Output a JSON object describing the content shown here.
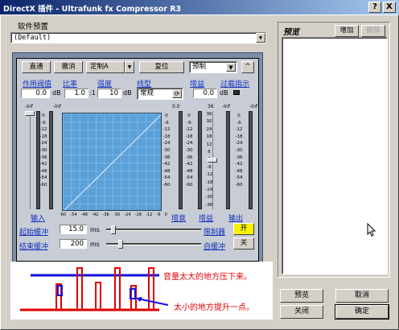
{
  "window": {
    "title": "DirectX 插件 - Ultrafunk fx Compressor R3",
    "help_label": "?",
    "close_label": "X"
  },
  "preset": {
    "label": "软件预置",
    "value": "(Default)"
  },
  "toolbar": {
    "direct": "直通",
    "undo": "撤消",
    "define": "定制A",
    "reset": "复位",
    "presets": "预制",
    "collapse": "^"
  },
  "params": {
    "attack": {
      "label": "作用阀值",
      "value": "0.0",
      "unit": "dB"
    },
    "ratio": {
      "label": "比率",
      "value": "1.0",
      "unit": ":1"
    },
    "strength": {
      "label": "强度",
      "value": "10",
      "unit": "dB"
    },
    "curve": {
      "label": "线型",
      "value": "常规"
    },
    "gain": {
      "label": "增益",
      "value": "0.0",
      "unit": "dB"
    },
    "oversample": {
      "label": "过载指示"
    }
  },
  "meters": {
    "input_top": [
      "-Inf",
      "-Inf"
    ],
    "input_scale": [
      "0",
      "-6",
      "-12",
      "-18",
      "-24",
      "-30",
      "-36",
      "-42",
      "-48",
      "-54",
      "-60"
    ],
    "gr_top": "0.0",
    "gr_scale": [
      "0",
      "-6",
      "-12",
      "-18",
      "-24",
      "-30",
      "-36",
      "-42",
      "-48",
      "-54",
      "-60"
    ],
    "gain_scale": [
      "36",
      "30",
      "24",
      "18",
      "12",
      "6",
      "0",
      "-6",
      "-12",
      "-18",
      "-24",
      "-30",
      "-36"
    ],
    "gain_top": "36",
    "output_top": [
      "-Inf",
      "-Inf"
    ],
    "output_scale": [
      "0",
      "-6",
      "-12",
      "-18",
      "-24",
      "-30",
      "-36",
      "-42",
      "-48",
      "-54",
      "-60"
    ],
    "graph_x": [
      "-60",
      "-54",
      "-48",
      "-42",
      "-36",
      "-30",
      "-24",
      "-18",
      "-12",
      "-6",
      "0"
    ],
    "graph_y": [
      "0",
      "-6",
      "-12",
      "-18",
      "-24",
      "-30",
      "-36",
      "-42",
      "-48",
      "-54",
      "-60"
    ]
  },
  "labels": {
    "input": "输入",
    "reduction": "增衰",
    "gain": "增益",
    "output": "输出"
  },
  "bottom": {
    "attack_label": "起始缓冲",
    "attack_value": "15.0",
    "attack_unit": "ms",
    "release_label": "结束缓冲",
    "release_value": "200",
    "release_unit": "ms",
    "limit_label": "限制器",
    "limit_state": "开",
    "auto_label": "自缓冲",
    "auto_state": "关"
  },
  "preview": {
    "title": "预览",
    "add": "增加",
    "remove": "删除"
  },
  "dialog": {
    "preview": "预览",
    "cancel": "取消",
    "close": "关闭",
    "ok": "确定"
  },
  "annotation": {
    "loud": "音量太大的地方压下来。",
    "quiet": "太小的地方提升一点。"
  }
}
